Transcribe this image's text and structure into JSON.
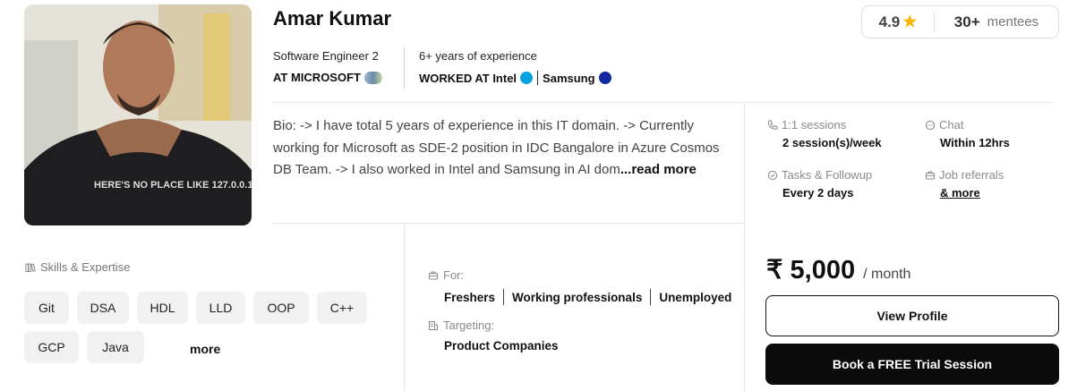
{
  "mentor": {
    "name": "Amar Kumar",
    "photo_text": "HERE'S NO PLACE LIKE 127.0.0.1",
    "role": "Software Engineer 2",
    "company": "AT MICROSOFT",
    "experience": "6+ years of experience",
    "worked_prefix": "WORKED AT Intel",
    "worked_second": "Samsung"
  },
  "stats": {
    "rating": "4.9",
    "mentees_count": "30+",
    "mentees_label": "mentees"
  },
  "bio": {
    "text": "Bio: -> I have total 5 years of experience in this IT domain. -> Currently working for Microsoft as SDE-2 position in IDC Bangalore in Azure Cosmos DB Team. -> I also worked in Intel and Samsung in AI dom",
    "read_more": "...read more"
  },
  "features": {
    "sessions": {
      "label": "1:1 sessions",
      "value": "2 session(s)/week"
    },
    "chat": {
      "label": "Chat",
      "value": "Within 12hrs"
    },
    "tasks": {
      "label": "Tasks & Followup",
      "value": "Every 2 days"
    },
    "referrals": {
      "label": "Job referrals",
      "value": "& more"
    }
  },
  "skills": {
    "title": "Skills & Expertise",
    "items": [
      "Git",
      "DSA",
      "HDL",
      "LLD",
      "OOP",
      "C++",
      "GCP",
      "Java"
    ],
    "more": "more"
  },
  "audience": {
    "for_label": "For:",
    "for_items": [
      "Freshers",
      "Working professionals",
      "Unemployed"
    ],
    "targeting_label": "Targeting:",
    "targeting_value": "Product Companies"
  },
  "pricing": {
    "amount": "₹ 5,000",
    "unit": "/ month"
  },
  "actions": {
    "view_profile": "View Profile",
    "book_trial": "Book a FREE Trial Session"
  },
  "colors": {
    "primary_button": "#0b0b0b",
    "star": "#f7b500",
    "intel": "#0aa1e0",
    "samsung": "#1428a0"
  },
  "icons": [
    "phone-icon",
    "chat-icon",
    "check-circle-icon",
    "briefcase-icon",
    "books-icon",
    "building-icon",
    "star-icon"
  ]
}
